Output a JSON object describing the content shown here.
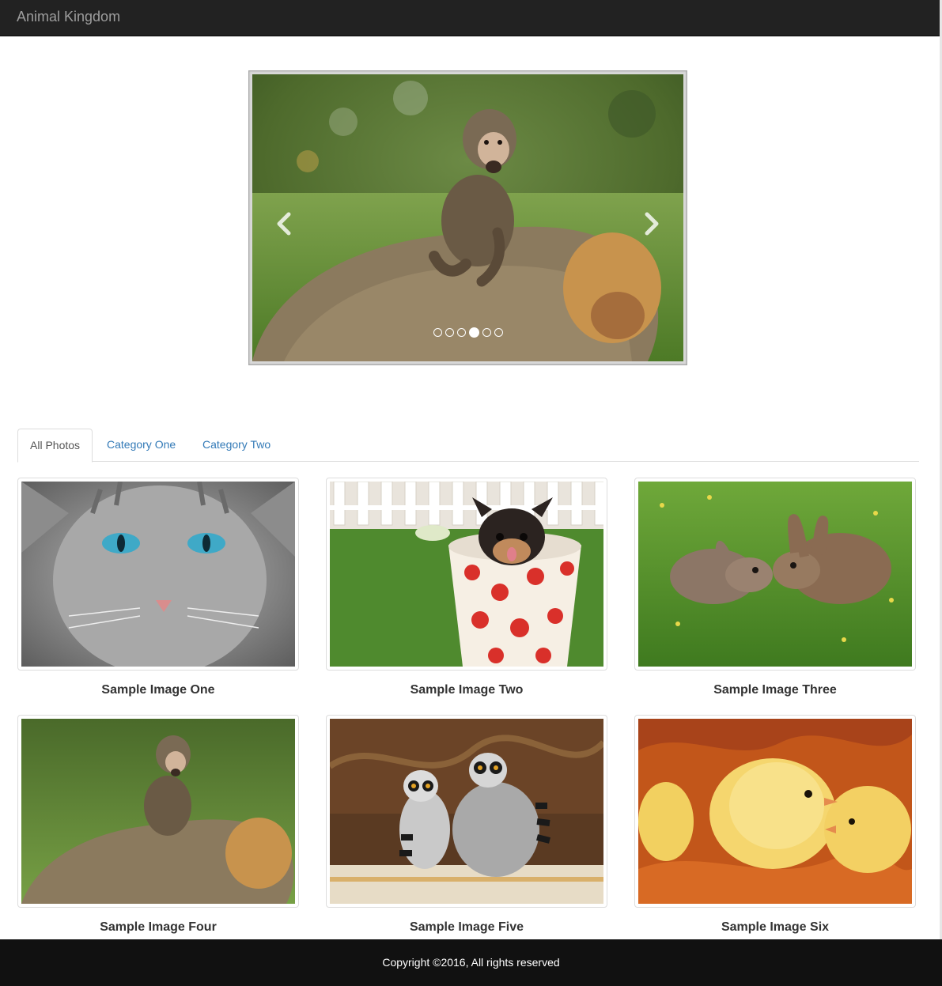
{
  "navbar": {
    "brand": "Animal Kingdom"
  },
  "carousel": {
    "slide_count": 6,
    "active_index": 3,
    "prev_icon": "chevron-left-icon",
    "next_icon": "chevron-right-icon"
  },
  "tabs": [
    {
      "label": "All Photos",
      "active": true
    },
    {
      "label": "Category One",
      "active": false
    },
    {
      "label": "Category Two",
      "active": false
    }
  ],
  "gallery": [
    {
      "caption": "Sample Image One"
    },
    {
      "caption": "Sample Image Two"
    },
    {
      "caption": "Sample Image Three"
    },
    {
      "caption": "Sample Image Four"
    },
    {
      "caption": "Sample Image Five"
    },
    {
      "caption": "Sample Image Six"
    }
  ],
  "footer": {
    "copyright": "Copyright ©2016, All rights reserved"
  },
  "colors": {
    "navbar_bg": "#222222",
    "brand_text": "#9d9d9d",
    "tab_link": "#337ab7",
    "footer_bg": "#111111"
  }
}
